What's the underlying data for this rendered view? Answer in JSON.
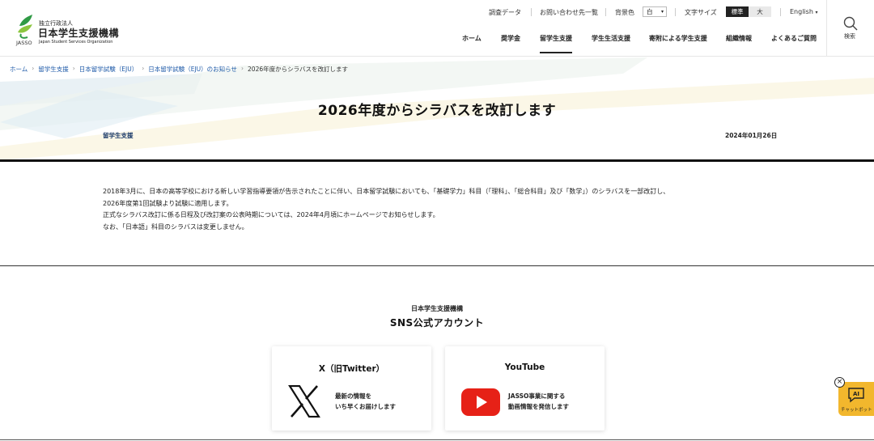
{
  "header": {
    "logo": {
      "prefix": "独立行政法人",
      "name": "日本学生支援機構",
      "name_en": "Japan Student Services Organization",
      "abbr": "JASSO"
    },
    "utility": {
      "survey_data": "調査データ",
      "contacts": "お問い合わせ先一覧",
      "bg_color_label": "背景色",
      "bg_color_value": "白",
      "font_size_label": "文字サイズ",
      "font_size_standard": "標準",
      "font_size_large": "大",
      "language": "English"
    },
    "nav": [
      "ホーム",
      "奨学金",
      "留学生支援",
      "学生生活支援",
      "寄附による学生支援",
      "組織情報",
      "よくあるご質問"
    ],
    "nav_active": "留学生支援",
    "search_label": "検索"
  },
  "breadcrumb": [
    "ホーム",
    "留学生支援",
    "日本留学試験（EJU）",
    "日本留学試験（EJU）のお知らせ",
    "2026年度からシラバスを改訂します"
  ],
  "article": {
    "title": "2026年度からシラバスを改訂します",
    "category": "留学生支援",
    "date": "2024年01月26日",
    "paragraphs": [
      "2018年3月に、日本の高等学校における新しい学習指導要領が告示されたことに伴い、日本留学試験においても、「基礎学力」科目（「理科」、「総合科目」及び「数学」）のシラバスを一部改訂し、",
      "2026年度第1回試験より試験に適用します。",
      "正式なシラバス改訂に係る日程及び改訂案の公表時期については、2024年4月頃にホームページでお知らせします。",
      "なお、「日本語」科目のシラバスは変更しません。"
    ]
  },
  "sns": {
    "org": "日本学生支援機構",
    "title": "SNS公式アカウント",
    "x": {
      "title": "X（旧Twitter）",
      "desc_line1": "最新の情報を",
      "desc_line2": "いち早くお届けします"
    },
    "youtube": {
      "title": "YouTube",
      "desc_line1": "JASSO事業に関する",
      "desc_line2": "動画情報を発信します"
    }
  },
  "chatbot": {
    "label": "チャットボット",
    "badge": "AI",
    "close": "×"
  },
  "colors": {
    "link": "#1e5aa8",
    "logo_green": "#2f9a45",
    "youtube_red": "#e62117",
    "chatbot": "#f2b72d"
  }
}
